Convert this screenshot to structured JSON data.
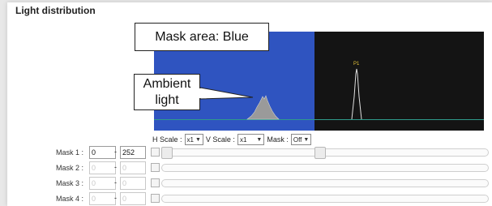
{
  "panel": {
    "title": "Light distribution"
  },
  "plot": {
    "peak_label": "P1",
    "mask_color": "#2f54c0",
    "background_color": "#141414"
  },
  "callouts": {
    "mask_area": "Mask area: Blue",
    "ambient_line1": "Ambient",
    "ambient_line2": "light"
  },
  "controls": {
    "h_scale_label": "H Scale :",
    "h_scale_value": "x1",
    "v_scale_label": "V Scale :",
    "v_scale_value": "x1",
    "mask_label": "Mask :",
    "mask_value": "Off"
  },
  "masks": [
    {
      "label": "Mask 1 :",
      "from": "0",
      "to": "252",
      "enabled": true
    },
    {
      "label": "Mask 2 :",
      "from": "0",
      "to": "0",
      "enabled": false
    },
    {
      "label": "Mask 3 :",
      "from": "0",
      "to": "0",
      "enabled": false
    },
    {
      "label": "Mask 4 :",
      "from": "0",
      "to": "0",
      "enabled": false
    }
  ]
}
